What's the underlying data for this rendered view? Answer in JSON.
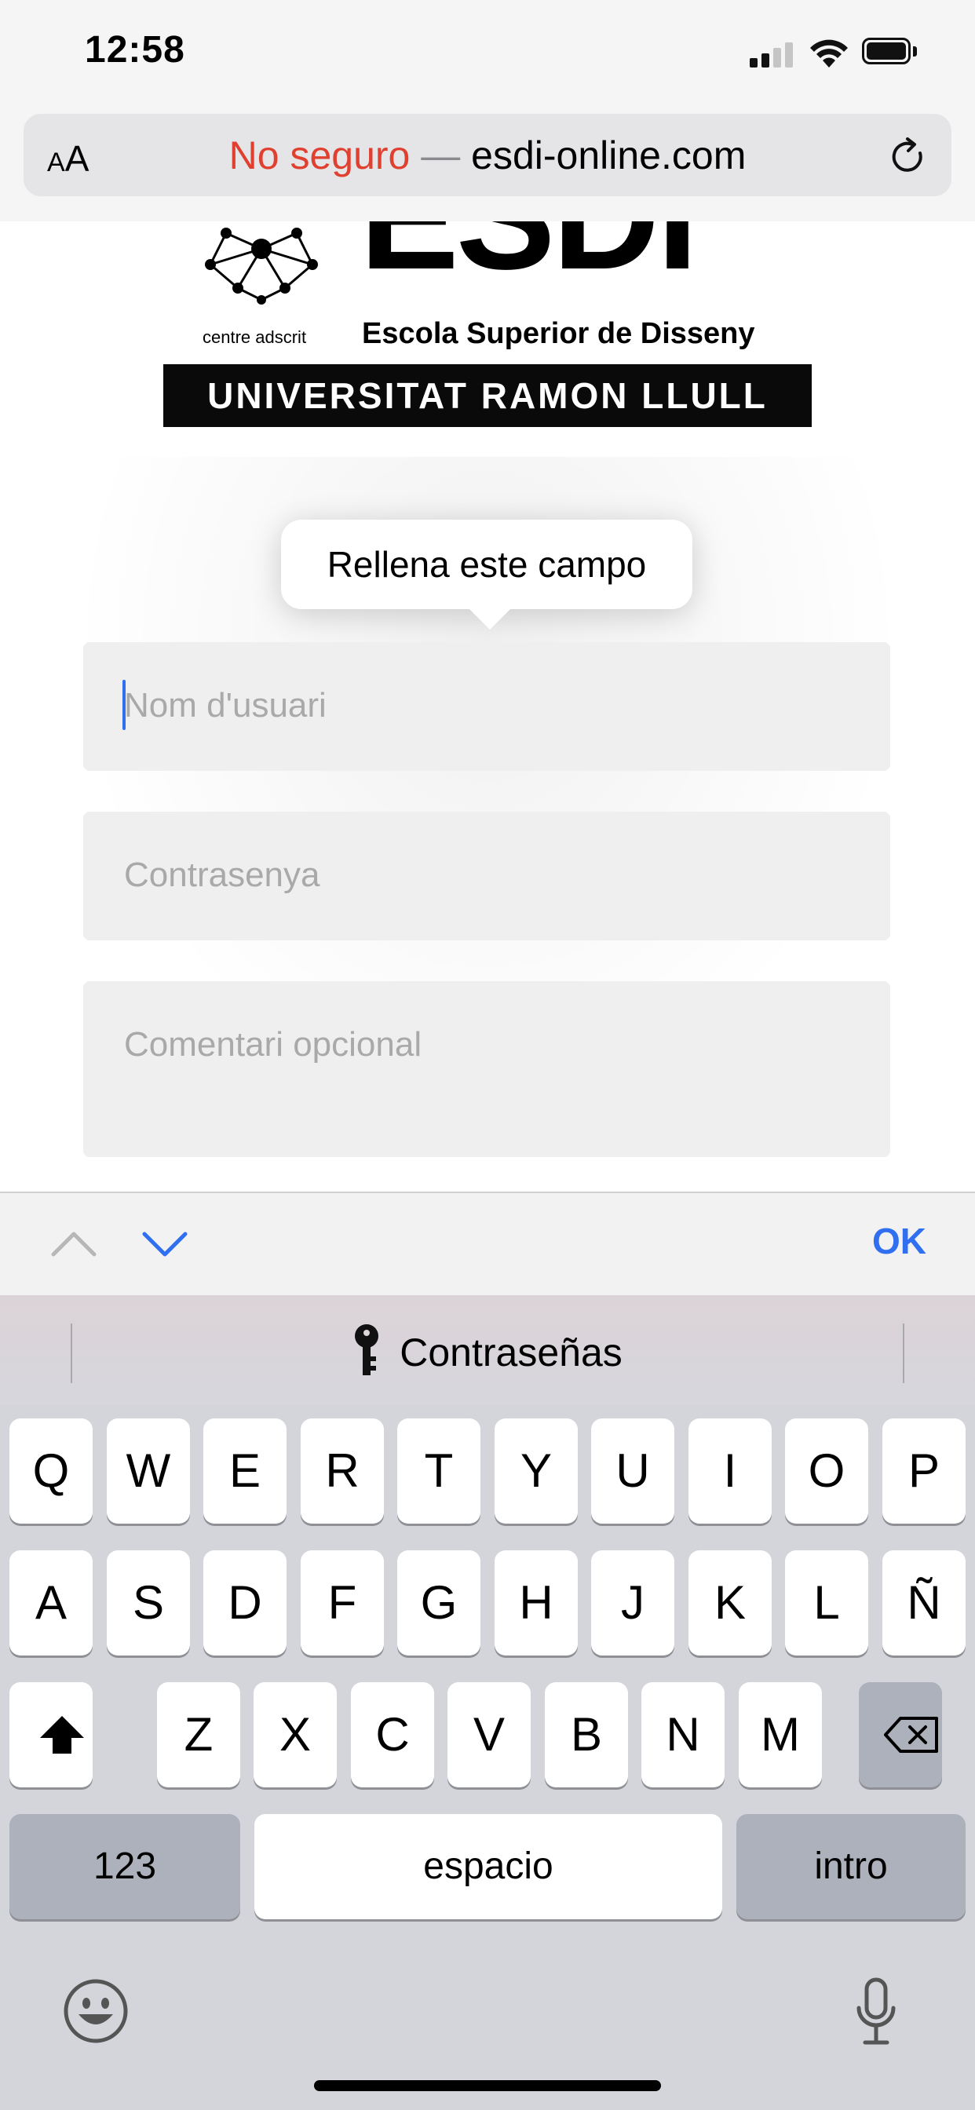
{
  "status_bar": {
    "time": "12:58"
  },
  "browser": {
    "text_size_small": "A",
    "text_size_large": "A",
    "not_secure": "No seguro",
    "separator": "—",
    "url": "esdi-online.com"
  },
  "logo": {
    "wordmark": "ESDI",
    "adscrit": "centre adscrit",
    "school": "Escola Superior de Disseny",
    "university": "UNIVERSITAT RAMON LLULL"
  },
  "tooltip": {
    "text": "Rellena este campo"
  },
  "form": {
    "username_placeholder": "Nom d'usuari",
    "password_placeholder": "Contrasenya",
    "comment_placeholder": "Comentari opcional"
  },
  "accessory": {
    "ok": "OK"
  },
  "keyboard": {
    "suggestion": "Contraseñas",
    "row1": [
      "Q",
      "W",
      "E",
      "R",
      "T",
      "Y",
      "U",
      "I",
      "O",
      "P"
    ],
    "row2": [
      "A",
      "S",
      "D",
      "F",
      "G",
      "H",
      "J",
      "K",
      "L",
      "Ñ"
    ],
    "row3": [
      "Z",
      "X",
      "C",
      "V",
      "B",
      "N",
      "M"
    ],
    "numbers": "123",
    "space": "espacio",
    "enter": "intro"
  },
  "colors": {
    "accent": "#2f6ff0",
    "not_secure": "#e0402f"
  }
}
